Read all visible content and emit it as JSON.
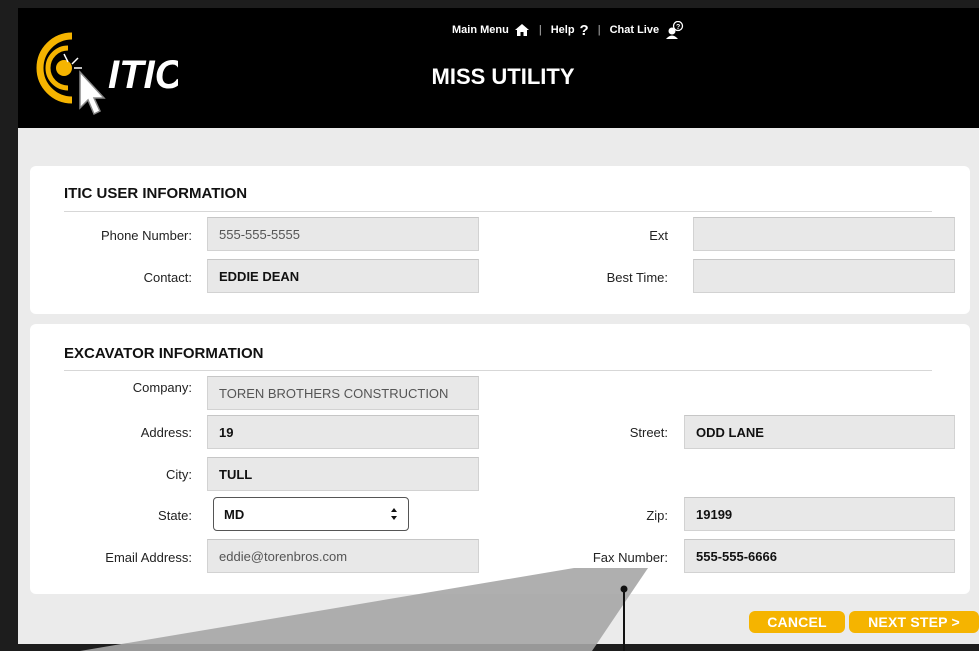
{
  "header": {
    "logo_text": "ITIC",
    "page_title": "MISS UTILITY",
    "nav": {
      "main_menu": "Main Menu",
      "help": "Help",
      "chat_live": "Chat Live",
      "separator": "|"
    }
  },
  "user_info": {
    "title": "ITIC USER INFORMATION",
    "phone_label": "Phone Number:",
    "phone_value": "555-555-5555",
    "ext_label": "Ext",
    "ext_value": "",
    "contact_label": "Contact:",
    "contact_value": "EDDIE DEAN",
    "best_time_label": "Best Time:",
    "best_time_value": ""
  },
  "excavator": {
    "title": "EXCAVATOR INFORMATION",
    "company_label": "Company:",
    "company_value": "TOREN BROTHERS CONSTRUCTION",
    "address_label": "Address:",
    "address_value": "19",
    "street_label": "Street:",
    "street_value": "ODD LANE",
    "city_label": "City:",
    "city_value": "TULL",
    "state_label": "State:",
    "state_value": "MD",
    "zip_label": "Zip:",
    "zip_value": "19199",
    "email_label": "Email Address:",
    "email_value": "eddie@torenbros.com",
    "fax_label": "Fax Number:",
    "fax_value": "555-555-6666"
  },
  "actions": {
    "cancel": "CANCEL",
    "next": "NEXT STEP >"
  },
  "colors": {
    "accent": "#f5b400",
    "header_bg": "#000000",
    "panel_bg": "#ffffff",
    "page_bg": "#ebebeb"
  },
  "icons": {
    "main_menu": "home-icon",
    "help": "question-icon",
    "chat_live": "chat-person-icon",
    "logo": "itic-logo-cursor-icon",
    "select_arrows": "updown-arrows-icon"
  }
}
